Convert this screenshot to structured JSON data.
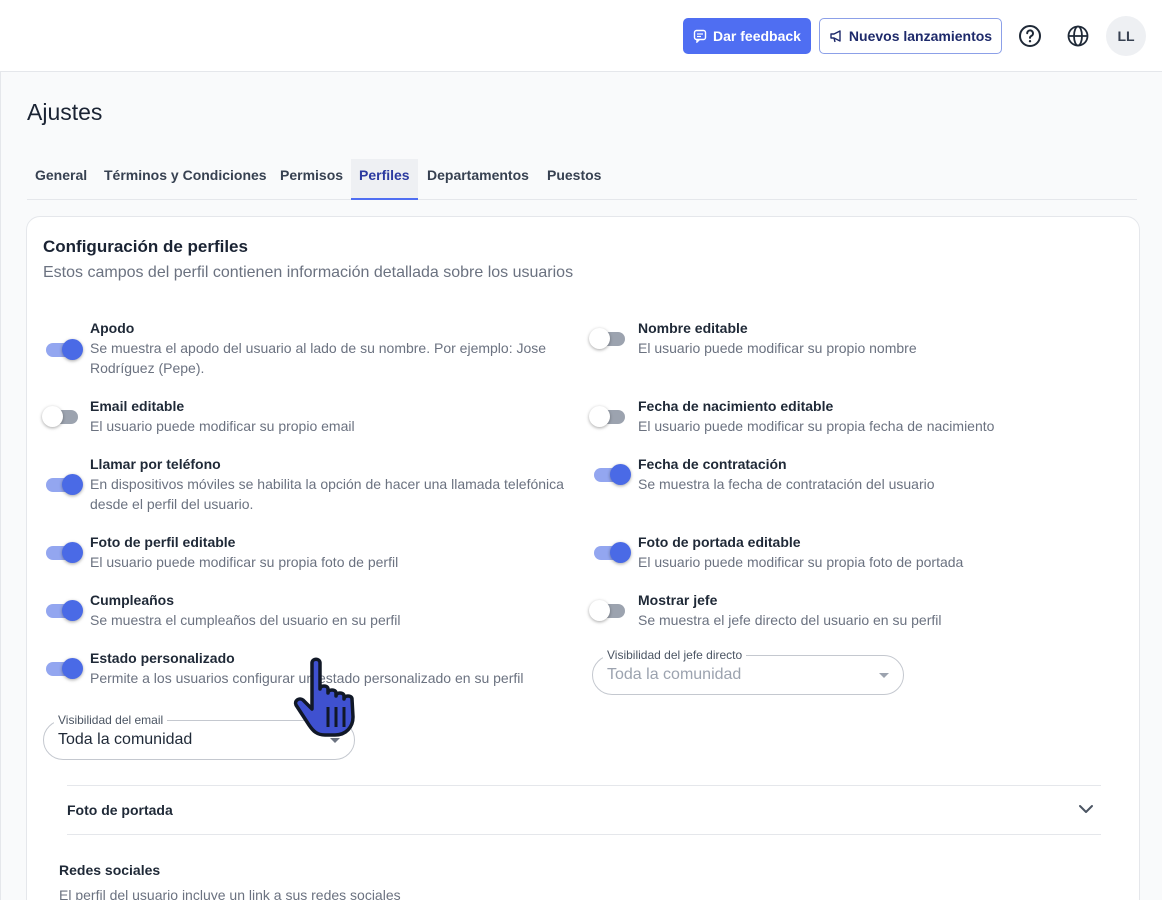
{
  "header": {
    "feedback_label": "Dar feedback",
    "releases_label": "Nuevos lanzamientos",
    "avatar_initials": "LL",
    "icons": [
      "chat-icon",
      "megaphone-icon",
      "help-icon",
      "globe-icon"
    ]
  },
  "page": {
    "title": "Ajustes",
    "tabs": [
      {
        "label": "General",
        "active": false
      },
      {
        "label": "Términos y Condiciones",
        "active": false
      },
      {
        "label": "Permisos",
        "active": false
      },
      {
        "label": "Perfiles",
        "active": true
      },
      {
        "label": "Departamentos",
        "active": false
      },
      {
        "label": "Puestos",
        "active": false
      }
    ]
  },
  "card": {
    "title": "Configuración de perfiles",
    "subtitle": "Estos campos del perfil contienen información detallada sobre los usuarios",
    "left_settings": [
      {
        "label": "Apodo",
        "desc": "Se muestra el apodo del usuario al lado de su nombre. Por ejemplo: Jose Rodríguez (Pepe).",
        "enabled": true
      },
      {
        "label": "Email editable",
        "desc": "El usuario puede modificar su propio email",
        "enabled": false
      },
      {
        "label": "Llamar por teléfono",
        "desc": "En dispositivos móviles se habilita la opción de hacer una llamada telefónica desde el perfil del usuario.",
        "enabled": true
      },
      {
        "label": "Foto de perfil editable",
        "desc": "El usuario puede modificar su propia foto de perfil",
        "enabled": true
      },
      {
        "label": "Cumpleaños",
        "desc": "Se muestra el cumpleaños del usuario en su perfil",
        "enabled": true
      },
      {
        "label": "Estado personalizado",
        "desc": "Permite a los usuarios configurar un estado personalizado en su perfil",
        "enabled": true
      }
    ],
    "right_settings": [
      {
        "label": "Nombre editable",
        "desc": "El usuario puede modificar su propio nombre",
        "enabled": false
      },
      {
        "label": "Fecha de nacimiento editable",
        "desc": "El usuario puede modificar su propia fecha de nacimiento",
        "enabled": false
      },
      {
        "label": "Fecha de contratación",
        "desc": "Se muestra la fecha de contratación del usuario",
        "enabled": true
      },
      {
        "label": "Foto de portada editable",
        "desc": "El usuario puede modificar su propia foto de portada",
        "enabled": true
      },
      {
        "label": "Mostrar jefe",
        "desc": "Se muestra el jefe directo del usuario en su perfil",
        "enabled": false
      }
    ],
    "boss_visibility": {
      "legend": "Visibilidad del jefe directo",
      "value": "Toda la comunidad",
      "disabled": true
    },
    "email_visibility": {
      "legend": "Visibilidad del email",
      "value": "Toda la comunidad",
      "disabled": false
    },
    "accordion": {
      "title": "Foto de portada"
    },
    "social": {
      "title": "Redes sociales",
      "desc": "El perfil del usuario incluye un link a sus redes sociales"
    }
  },
  "colors": {
    "accent": "#4f6ef2",
    "toggle_on": "#4a6ae6",
    "toggle_track_on": "#93a6f0",
    "toggle_off": "#9ca3af"
  }
}
